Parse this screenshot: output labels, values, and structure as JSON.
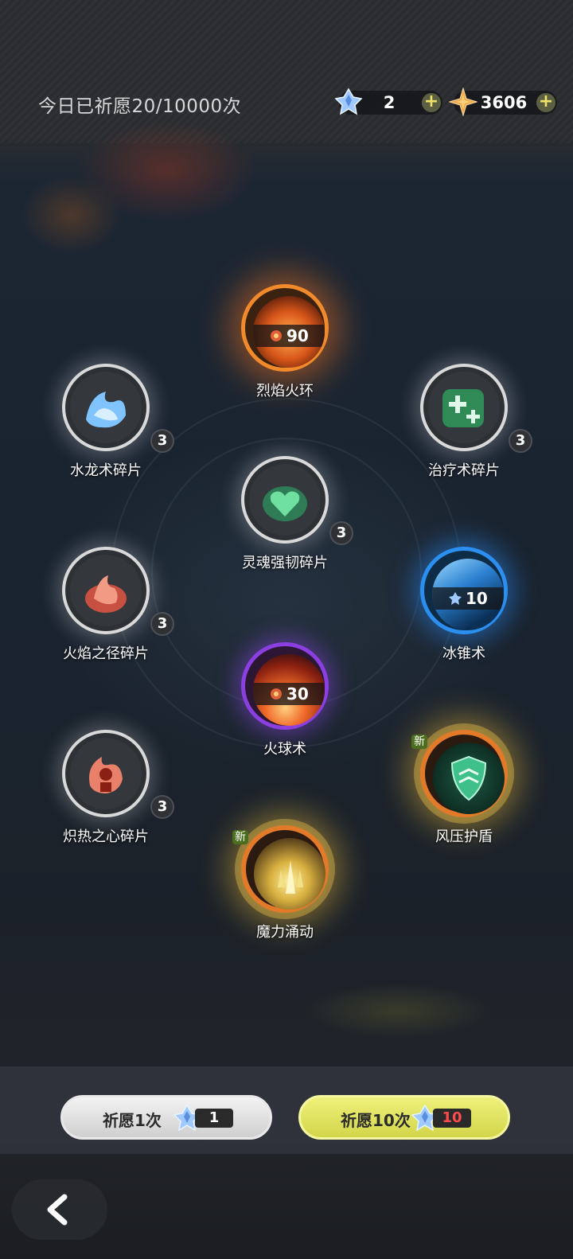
{
  "header": {
    "wish_count_text": "今日已祈愿20/10000次",
    "currencies": [
      {
        "icon": "crystal-icon",
        "value": "2"
      },
      {
        "icon": "star-gem-icon",
        "value": "3606"
      }
    ],
    "plus_label": "+"
  },
  "items": [
    {
      "name": "烈焰火环",
      "type": "skill",
      "cost": "90",
      "frame": "orange"
    },
    {
      "name": "水龙术碎片",
      "type": "fragment",
      "count": "3",
      "art_color": "#7fc4ff"
    },
    {
      "name": "治疗术碎片",
      "type": "fragment",
      "count": "3",
      "art_color": "#3fbf70"
    },
    {
      "name": "灵魂强韧碎片",
      "type": "fragment",
      "count": "3",
      "art_color": "#5ccf86"
    },
    {
      "name": "火焰之径碎片",
      "type": "fragment",
      "count": "3",
      "art_color": "#f0705a"
    },
    {
      "name": "冰锥术",
      "type": "skill",
      "cost": "10",
      "frame": "blue"
    },
    {
      "name": "火球术",
      "type": "skill",
      "cost": "30",
      "frame": "purple"
    },
    {
      "name": "炽热之心碎片",
      "type": "fragment",
      "count": "3",
      "art_color": "#ef6a55"
    },
    {
      "name": "风压护盾",
      "type": "new",
      "tag": "新",
      "frame": "gold"
    },
    {
      "name": "魔力涌动",
      "type": "new",
      "tag": "新",
      "frame": "gold"
    }
  ],
  "buttons": {
    "wish_one": {
      "label": "祈愿1次",
      "cost": "1"
    },
    "wish_ten": {
      "label": "祈愿10次",
      "cost": "10"
    }
  },
  "colors": {
    "accent_yellow": "#e6e862",
    "cost_red": "#ff4b4b",
    "new_tag_green": "#4a6d1e"
  }
}
